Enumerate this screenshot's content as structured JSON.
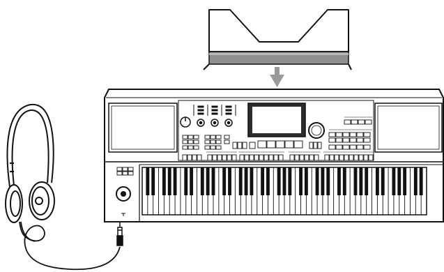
{
  "diagram": {
    "items": [
      {
        "name": "music-stand",
        "kind": "illustration"
      },
      {
        "name": "attach-arrow",
        "kind": "arrow"
      },
      {
        "name": "keyboard",
        "kind": "illustration",
        "white_keys": 52
      },
      {
        "name": "headphones",
        "kind": "illustration"
      },
      {
        "name": "headphone-plug",
        "kind": "illustration"
      }
    ],
    "colors": {
      "line": "#111111",
      "arrow": "#9a9a9a",
      "stand_bar": "#8f8f8f",
      "screen": "#2b2b2b",
      "black_keys": "#111111"
    }
  }
}
